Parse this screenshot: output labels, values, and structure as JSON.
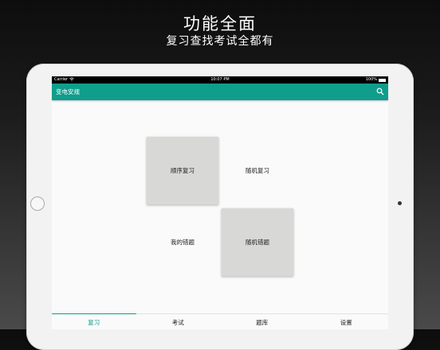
{
  "promo": {
    "headline": "功能全面",
    "subline": "复习查找考试全都有"
  },
  "status_bar": {
    "carrier": "Carrier",
    "time": "10:07 PM",
    "battery": "100%"
  },
  "app_bar": {
    "title": "变电安规",
    "search_icon": "search-icon"
  },
  "menu": {
    "sequential_review": "顺序复习",
    "random_review": "随机复习",
    "my_mistakes": "我的错题",
    "random_mistakes": "随机错题"
  },
  "tabs": [
    {
      "label": "复习",
      "active": true
    },
    {
      "label": "考试",
      "active": false
    },
    {
      "label": "题库",
      "active": false
    },
    {
      "label": "设置",
      "active": false
    }
  ],
  "colors": {
    "accent": "#0f9e8c",
    "tile": "#d8d8d7"
  }
}
